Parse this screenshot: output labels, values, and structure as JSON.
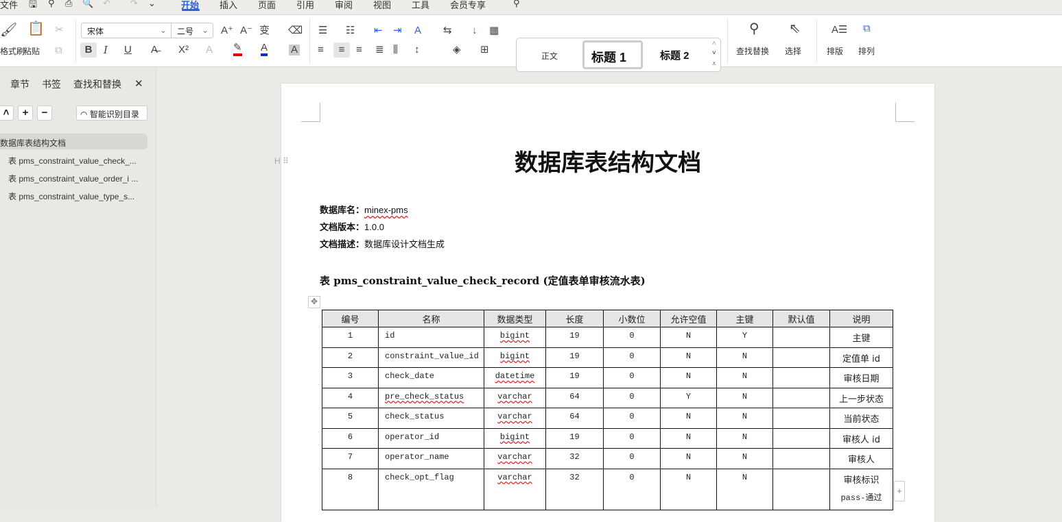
{
  "menubar": {
    "file": "文件",
    "tabs": [
      "开始",
      "插入",
      "页面",
      "引用",
      "审阅",
      "视图",
      "工具",
      "会员专享"
    ],
    "active_tab": "开始"
  },
  "ribbon": {
    "format_painter": "格式刷",
    "paste": "粘贴",
    "font_name": "宋体",
    "font_size": "二号",
    "styles": [
      "正文",
      "标题 1",
      "标题 2"
    ],
    "find_replace": "查找替换",
    "select": "选择",
    "layout": "排版",
    "arrange": "排列",
    "font_color": "#e00000",
    "highlight_color": "#e00000",
    "text_color_blue": "#0a2dd6"
  },
  "leftpanel": {
    "tabs": [
      "章节",
      "书签",
      "查找和替换"
    ],
    "smart_toc": "智能识别目录",
    "toc": [
      "数据库表结构文档",
      "表 pms_constraint_value_check_...",
      "表 pms_constraint_value_order_i ...",
      "表 pms_constraint_value_type_s..."
    ]
  },
  "doc": {
    "title": "数据库表结构文档",
    "db_label": "数据库名：",
    "db_value": "minex-pms",
    "ver_label": "文档版本：",
    "ver_value": "1.0.0",
    "desc_label": "文档描述：",
    "desc_value": "数据库设计文档生成",
    "table_heading": "表 pms_constraint_value_check_record (定值表单审核流水表)",
    "headers": [
      "编号",
      "名称",
      "数据类型",
      "长度",
      "小数位",
      "允许空值",
      "主键",
      "默认值",
      "说明"
    ],
    "rows": [
      [
        "1",
        "id",
        "bigint",
        "19",
        "0",
        "N",
        "Y",
        "",
        "主键"
      ],
      [
        "2",
        "constraint_value_id",
        "bigint",
        "19",
        "0",
        "N",
        "N",
        "",
        "定值单 id"
      ],
      [
        "3",
        "check_date",
        "datetime",
        "19",
        "0",
        "N",
        "N",
        "",
        "审核日期"
      ],
      [
        "4",
        "pre_check_status",
        "varchar",
        "64",
        "0",
        "Y",
        "N",
        "",
        "上一步状态"
      ],
      [
        "5",
        "check_status",
        "varchar",
        "64",
        "0",
        "N",
        "N",
        "",
        "当前状态"
      ],
      [
        "6",
        "operator_id",
        "bigint",
        "19",
        "0",
        "N",
        "N",
        "",
        "审核人 id"
      ],
      [
        "7",
        "operator_name",
        "varchar",
        "32",
        "0",
        "N",
        "N",
        "",
        "审核人"
      ],
      [
        "8",
        "check_opt_flag",
        "varchar",
        "32",
        "0",
        "N",
        "N",
        "",
        "审核标识"
      ]
    ],
    "row8_extra": "pass-通过"
  }
}
